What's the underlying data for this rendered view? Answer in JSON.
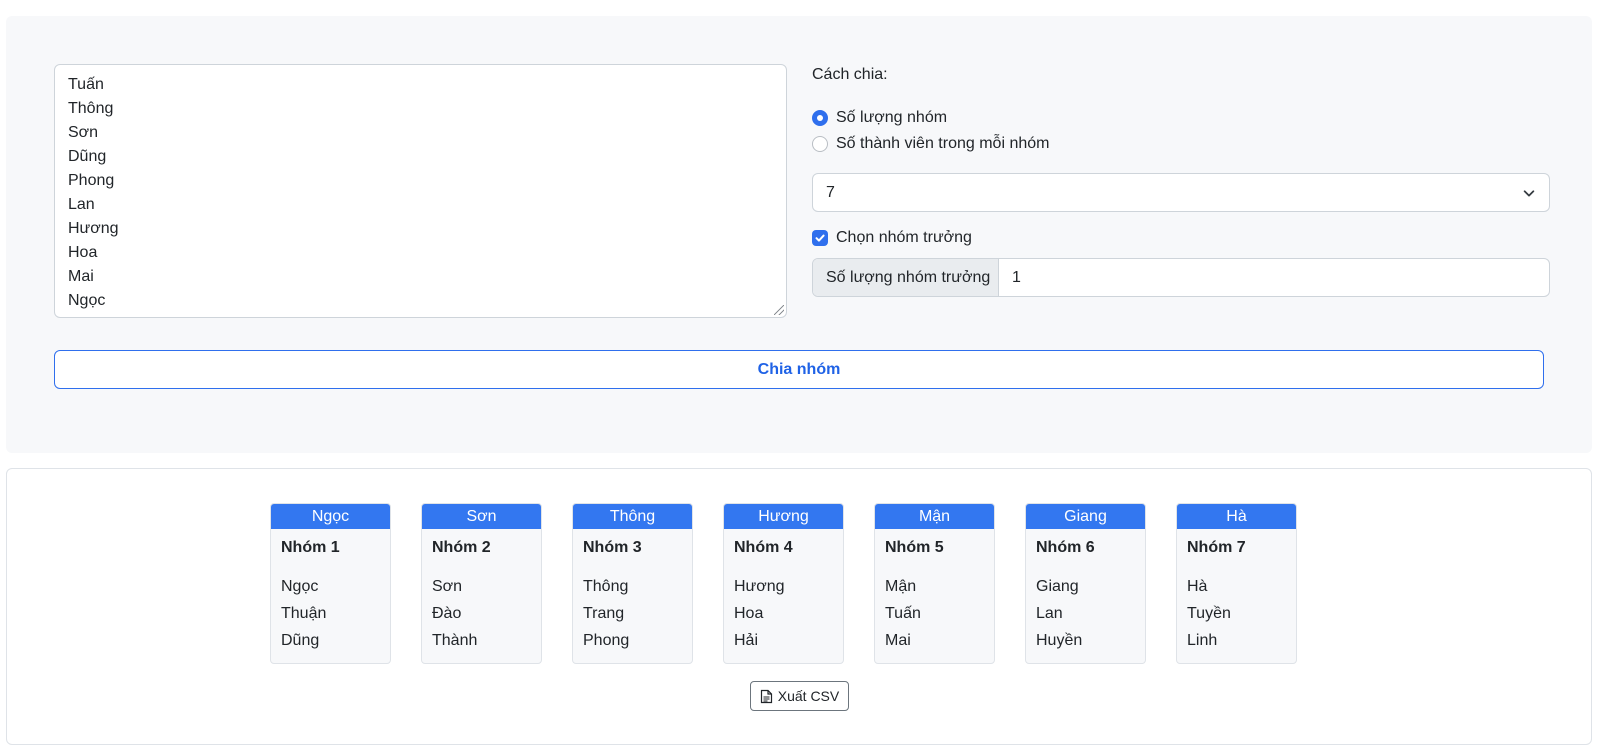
{
  "names": [
    "Tuấn",
    "Thông",
    "Sơn",
    "Dũng",
    "Phong",
    "Lan",
    "Hương",
    "Hoa",
    "Mai",
    "Ngọc"
  ],
  "options": {
    "mode_label": "Cách chia:",
    "radio_group_count": "Số lượng nhóm",
    "radio_members_per_group": "Số thành viên trong mỗi nhóm",
    "selected_mode": "group_count",
    "select_value": "7",
    "leader_checkbox_label": "Chọn nhóm trưởng",
    "leader_checked": true,
    "leader_count_label": "Số lượng nhóm trưởng",
    "leader_count_value": "1"
  },
  "split_button_label": "Chia nhóm",
  "groups": [
    {
      "leader": "Ngọc",
      "title": "Nhóm 1",
      "members": [
        "Ngọc",
        "Thuận",
        "Dũng"
      ]
    },
    {
      "leader": "Sơn",
      "title": "Nhóm 2",
      "members": [
        "Sơn",
        "Đào",
        "Thành"
      ]
    },
    {
      "leader": "Thông",
      "title": "Nhóm 3",
      "members": [
        "Thông",
        "Trang",
        "Phong"
      ]
    },
    {
      "leader": "Hương",
      "title": "Nhóm 4",
      "members": [
        "Hương",
        "Hoa",
        "Hải"
      ]
    },
    {
      "leader": "Mận",
      "title": "Nhóm 5",
      "members": [
        "Mận",
        "Tuấn",
        "Mai"
      ]
    },
    {
      "leader": "Giang",
      "title": "Nhóm 6",
      "members": [
        "Giang",
        "Lan",
        "Huyền"
      ]
    },
    {
      "leader": "Hà",
      "title": "Nhóm 7",
      "members": [
        "Hà",
        "Tuyền",
        "Linh"
      ]
    }
  ],
  "export_button_label": "Xuất CSV",
  "colors": {
    "accent": "#2f6fed",
    "group_header": "#3377f0",
    "panel_bg": "#f7f8fa"
  }
}
